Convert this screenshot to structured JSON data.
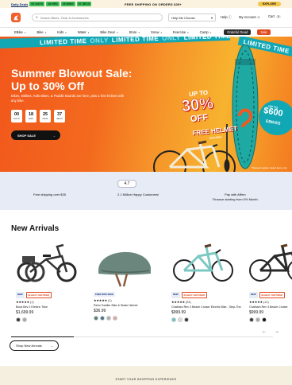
{
  "promo": {
    "deals_link": "Daily Deals",
    "timers": [
      "00 DAYS",
      "18 HRS",
      "25 MINS",
      "57 SECS"
    ],
    "shipping": "FREE SHIPPING ON ORDERS $35+",
    "explore": "EXPLORE"
  },
  "header": {
    "search_placeholder": "Search Bikes, Gear & Accessories",
    "store_select": "Help Me Choose",
    "help": "Help",
    "account": "My Account",
    "cart": "Cart",
    "cart_count": "0"
  },
  "nav": {
    "items": [
      "EBike",
      "Bike",
      "Kids",
      "Water",
      "Bike Gear",
      "Store",
      "Snow",
      "Exercise",
      "Camp"
    ],
    "grateful": "Grateful Dead",
    "sale": "Sale"
  },
  "hero": {
    "banner_text": "LIMITED TIME",
    "banner_light": "ONLY",
    "headline": "Summer Blowout Sale: Up to 30% Off",
    "subtext": "Bikes, EBikes, Kids Bikes, & Paddle Boards are here, plus a free helmet with any bike.",
    "countdown": [
      {
        "value": "00",
        "label": "DAYS"
      },
      {
        "value": "18",
        "label": "HRS"
      },
      {
        "value": "25",
        "label": "MINS"
      },
      {
        "value": "37",
        "label": "SECS"
      }
    ],
    "cta": "SHOP SALE",
    "badge_upto": "UP TO",
    "badge_pct": "30%",
    "badge_off": "OFF",
    "free_helmet": "FREE HELMET",
    "free_helmet_small": "WITH BIKE",
    "save_upto": "UP TO",
    "save_amount": "$600",
    "save_label": "EBIKES",
    "disclaimer": "*Discount applies. Select items only."
  },
  "trust": {
    "rating": "4.7",
    "shipping": "Free shipping over $35",
    "customers": "2.1 Million Happy Customers!",
    "affirm_line1": "Pay with Affirm",
    "affirm_line2": "Finance starting from 0% Month"
  },
  "arrivals": {
    "title": "New Arrivals",
    "products": [
      {
        "chips": [
          "NEW",
          "IN-HEAT CERTIFIED"
        ],
        "stars": "★★★★★",
        "count": "(1)",
        "name": "Boca Bev 2 Electric Trike",
        "price": "$1,699.99",
        "swatches": [
          "#3a3a3a",
          "#a9a9a9"
        ]
      },
      {
        "chips": [
          "FREE WITH BIKE"
        ],
        "stars": "★★★★★",
        "count": "(1)",
        "name": "Retro Toddler Bike & Skate Helmet",
        "price": "$36.99",
        "swatches": [
          "#5c7a7a",
          "#4a6f8a",
          "#b0b0b0",
          "#d9a9a0"
        ]
      },
      {
        "chips": [
          "NEW",
          "IN-HEAT CERTIFIED"
        ],
        "stars": "★★★★★",
        "count": "(54)",
        "name": "Chatham Rev 3 Beach Cruiser Electric Bike - Step-Through",
        "price": "$999.99",
        "swatches": [
          "#6fc3c0",
          "#e0dcd0",
          "#3a3a3a"
        ]
      },
      {
        "chips": [
          "NEW",
          "IN-HEAT CERTIFIED"
        ],
        "stars": "★★★★★",
        "count": "(12)",
        "name": "Chatham Rev 3 Beach Cruiser",
        "price": "$999.99",
        "swatches": [
          "#3a3a3a",
          "#a9a9a9",
          "#111111"
        ]
      }
    ],
    "prev": "←",
    "next": "→",
    "progress": 0.24,
    "shop_button": "Shop New Arrivals"
  },
  "footer": {
    "text": "START YOUR SHOPPING EXPERIENCE"
  }
}
